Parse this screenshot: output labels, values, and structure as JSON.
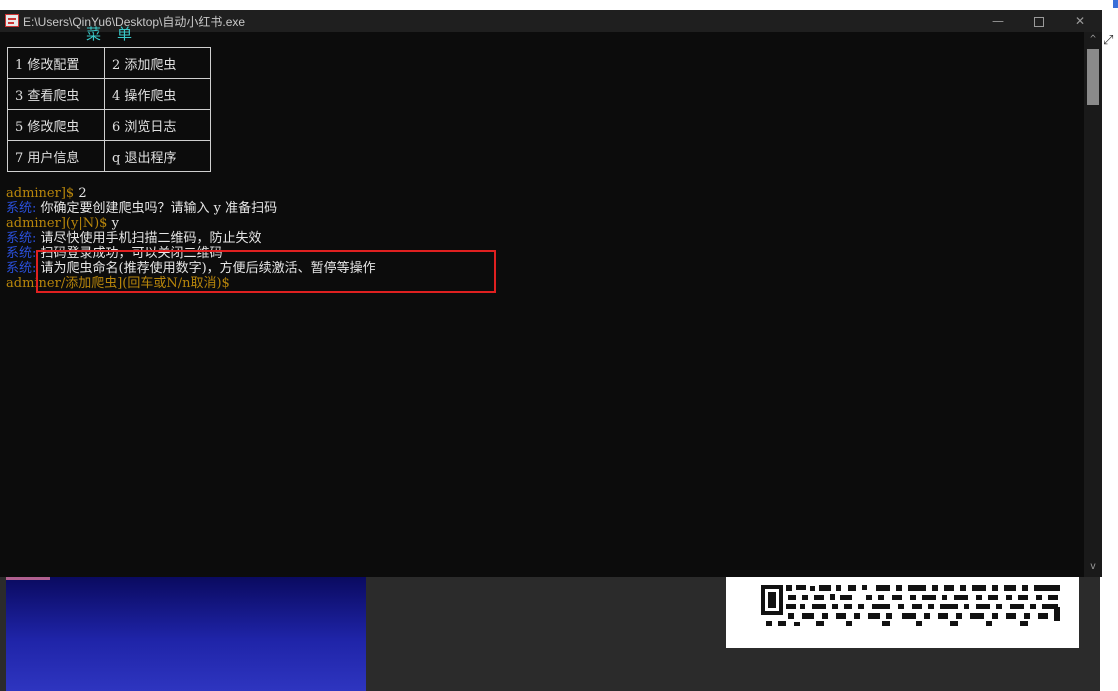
{
  "window": {
    "title": "E:\\Users\\QinYu6\\Desktop\\自动小红书.exe",
    "minimize_glyph": "—",
    "close_glyph": "✕"
  },
  "scrollbar": {
    "up_glyph": "^",
    "down_glyph": "v"
  },
  "edge_glyph": "⤢",
  "menu": {
    "title": "菜单",
    "rows": [
      [
        "1 修改配置",
        "2 添加爬虫"
      ],
      [
        "3 查看爬虫",
        "4 操作爬虫"
      ],
      [
        "5 修改爬虫",
        "6 浏览日志"
      ],
      [
        "7 用户信息",
        "q 退出程序"
      ]
    ]
  },
  "log": [
    {
      "prefix": "adminer]$ ",
      "text": "2"
    },
    {
      "prefix": "系统: ",
      "text": "你确定要创建爬虫吗？请输入 y 准备扫码"
    },
    {
      "prefix": "adminer](y|N)$ ",
      "text": "y"
    },
    {
      "prefix": "系统: ",
      "text": "请尽快使用手机扫描二维码，防止失效"
    },
    {
      "prefix": "系统: ",
      "text": "扫码登录成功，可以关闭二维码"
    },
    {
      "prefix": "系统: ",
      "text": "请为爬虫命名(推荐使用数字)，方便后续激活、暂停等操作"
    },
    {
      "prefix": "adminer/添加爬虫](回车或N/n取消)$",
      "text": ""
    }
  ],
  "colors": {
    "console_bg": "#0c0c0c",
    "prompt": "#b8860b",
    "system": "#2a4fd8",
    "menu_title": "#3ac8c8",
    "highlight": "#e02020"
  }
}
